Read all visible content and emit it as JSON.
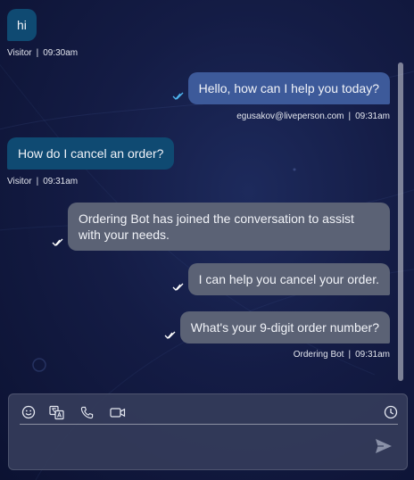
{
  "messages": [
    {
      "sender": "visitor",
      "text": "hi",
      "author": "Visitor",
      "time": "09:30am"
    },
    {
      "sender": "agent",
      "text": "Hello, how can I help you today?",
      "author": "egusakov@liveperson.com",
      "time": "09:31am"
    },
    {
      "sender": "visitor",
      "text": "How do I cancel an order?",
      "author": "Visitor",
      "time": "09:31am"
    },
    {
      "sender": "bot",
      "text": "Ordering Bot has joined the conversation to assist with your needs."
    },
    {
      "sender": "bot",
      "text": "I can help you cancel your order."
    },
    {
      "sender": "bot",
      "text": "What's your 9-digit order number?",
      "author": "Ordering Bot",
      "time": "09:31am"
    }
  ],
  "meta_separator": "|",
  "composer": {
    "placeholder": "",
    "icons": [
      "smiley-icon",
      "translate-icon",
      "phone-icon",
      "video-icon",
      "clock-icon",
      "send-icon"
    ]
  },
  "colors": {
    "background": "#141c45",
    "visitor_bubble": "#0f4a72",
    "agent_bubble": "#3d5a9a",
    "bot_bubble": "#5b6275",
    "read_check": "#4fb6f0"
  }
}
